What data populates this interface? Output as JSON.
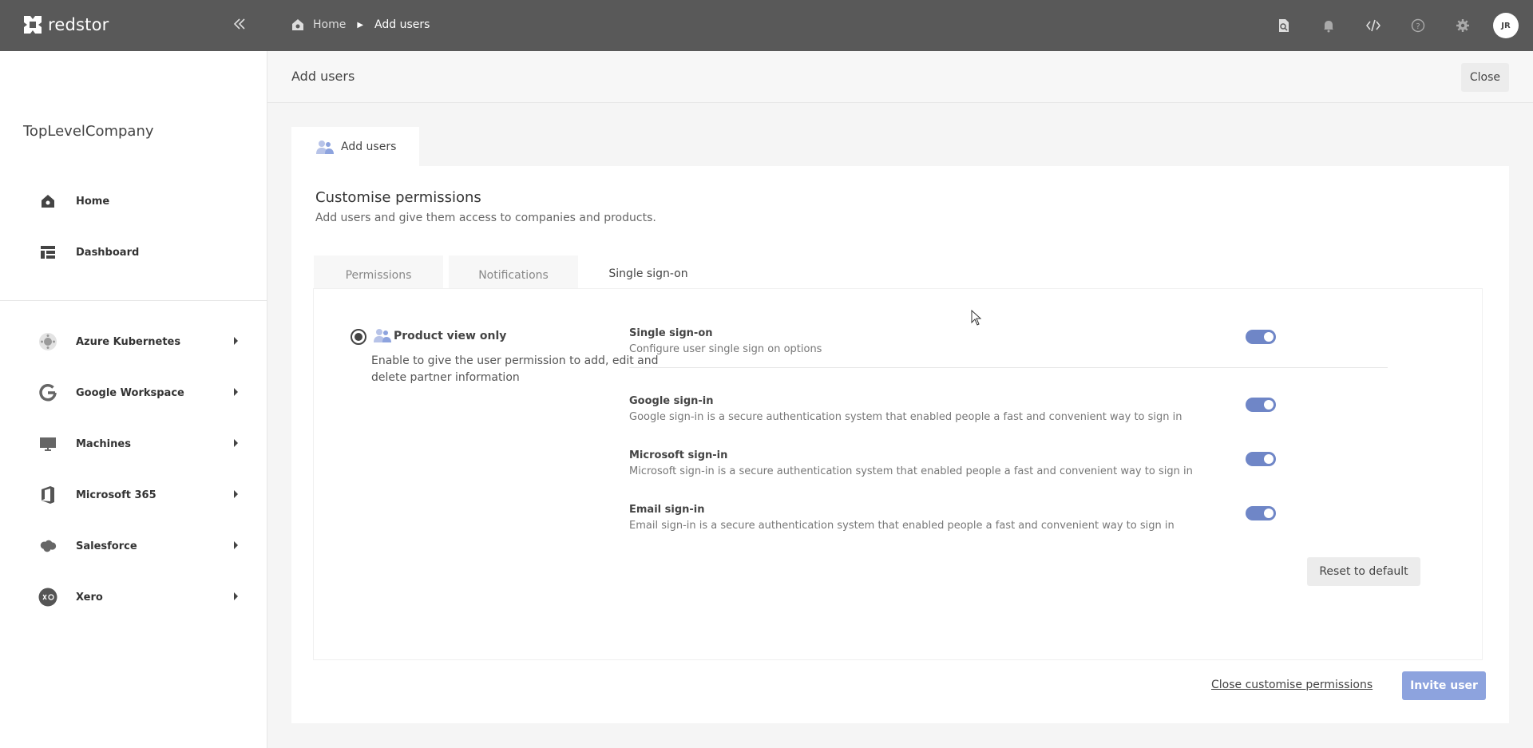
{
  "app": {
    "logo_text": "redstor"
  },
  "breadcrumb": {
    "home": "Home",
    "current": "Add users"
  },
  "topbar": {
    "avatar_initials": "JR",
    "icons": [
      "search-document-icon",
      "bell-icon",
      "code-icon",
      "help-icon",
      "gear-icon"
    ]
  },
  "sidebar": {
    "company": "TopLevelCompany",
    "primary": [
      {
        "label": "Home",
        "icon": "home-icon"
      },
      {
        "label": "Dashboard",
        "icon": "dashboard-icon"
      }
    ],
    "products": [
      {
        "label": "Azure Kubernetes",
        "icon": "kubernetes-icon"
      },
      {
        "label": "Google Workspace",
        "icon": "google-icon"
      },
      {
        "label": "Machines",
        "icon": "monitor-icon"
      },
      {
        "label": "Microsoft 365",
        "icon": "office-icon"
      },
      {
        "label": "Salesforce",
        "icon": "salesforce-icon"
      },
      {
        "label": "Xero",
        "icon": "xero-icon"
      }
    ]
  },
  "header": {
    "title": "Add users",
    "close_label": "Close"
  },
  "outer_tab": {
    "label": "Add users"
  },
  "section": {
    "title": "Customise permissions",
    "subtitle": "Add users and give them access to companies and products."
  },
  "inner_tabs": [
    {
      "label": "Permissions",
      "active": false
    },
    {
      "label": "Notifications",
      "active": false
    },
    {
      "label": "Single sign-on",
      "active": true
    }
  ],
  "product_view": {
    "title": "Product view only",
    "description": "Enable to give the user permission to add, edit and delete partner information"
  },
  "options": [
    {
      "title": "Single sign-on",
      "description": "Configure user single sign on options",
      "enabled": true
    },
    {
      "title": "Google sign-in",
      "description": "Google sign-in is a secure authentication system that enabled people a fast and convenient way to sign in",
      "enabled": true
    },
    {
      "title": "Microsoft sign-in",
      "description": "Microsoft sign-in is a secure authentication system that enabled people a fast and convenient way to sign in",
      "enabled": true
    },
    {
      "title": "Email sign-in",
      "description": "Email sign-in is a secure authentication system that enabled people a fast and convenient way to sign in",
      "enabled": true
    }
  ],
  "actions": {
    "reset_label": "Reset to default",
    "close_permissions_label": "Close customise permissions",
    "invite_label": "Invite user"
  },
  "colors": {
    "topbar": "#595959",
    "accent": "#6f86c7",
    "invite": "#8da3de"
  }
}
